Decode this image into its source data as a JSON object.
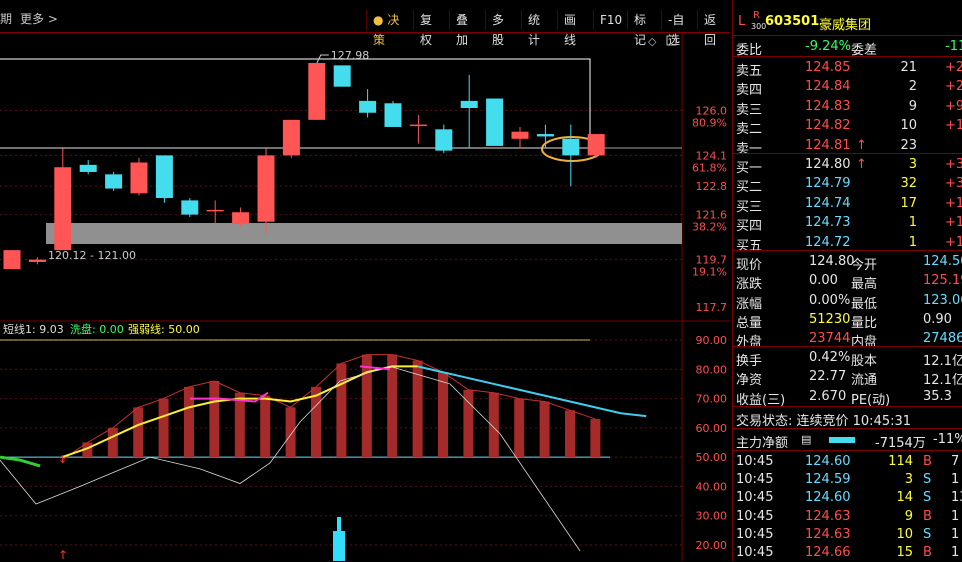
{
  "toolbar": {
    "left_items": [
      "期",
      "更多 >"
    ],
    "buttons": [
      "决策",
      "复权",
      "叠加",
      "多股",
      "统计",
      "画线",
      "F10",
      "标记",
      "-自选",
      "返回"
    ]
  },
  "main_chart": {
    "price_axis": [
      "126.0",
      "80.9%",
      "124.1",
      "61.8%",
      "122.8",
      "121.6",
      "38.2%",
      "119.7",
      "19.1%",
      "117.7"
    ],
    "high_label": "127.98",
    "range_label": "120.12 - 121.00",
    "indicator_line": {
      "name1": "短线1: 9.03",
      "name2": "洗盘: 0.00",
      "name3": "强弱线: 50.00"
    },
    "indicator_axis": [
      "90.00",
      "80.00",
      "70.00",
      "60.00",
      "50.00",
      "40.00",
      "30.00",
      "20.00"
    ],
    "colors": {
      "up": "#ff5555",
      "down": "#44ddee",
      "box": "#ffffff",
      "zone": "#909090",
      "ellipse": "#f0b040"
    }
  },
  "chart_data": {
    "type": "candlestick",
    "candles": [
      {
        "open": 119.3,
        "close": 120.1,
        "high": 120.1,
        "low": 119.3
      },
      {
        "open": 119.6,
        "close": 119.7,
        "high": 119.8,
        "low": 119.5
      },
      {
        "open": 120.1,
        "close": 123.6,
        "high": 124.4,
        "low": 120.1
      },
      {
        "open": 123.7,
        "close": 123.4,
        "high": 123.9,
        "low": 123.3
      },
      {
        "open": 123.3,
        "close": 122.7,
        "high": 123.4,
        "low": 122.6
      },
      {
        "open": 122.5,
        "close": 123.8,
        "high": 124.0,
        "low": 122.4
      },
      {
        "open": 124.1,
        "close": 122.3,
        "high": 124.1,
        "low": 122.1
      },
      {
        "open": 122.2,
        "close": 121.6,
        "high": 122.3,
        "low": 121.5
      },
      {
        "open": 121.8,
        "close": 121.8,
        "high": 122.2,
        "low": 121.2
      },
      {
        "open": 121.2,
        "close": 121.7,
        "high": 121.9,
        "low": 121.1
      },
      {
        "open": 121.3,
        "close": 124.1,
        "high": 124.4,
        "low": 120.8
      },
      {
        "open": 124.1,
        "close": 125.6,
        "high": 125.6,
        "low": 124.0
      },
      {
        "open": 125.6,
        "close": 128.0,
        "high": 128.0,
        "low": 125.6
      },
      {
        "open": 127.9,
        "close": 127.0,
        "high": 127.9,
        "low": 127.0
      },
      {
        "open": 126.4,
        "close": 125.9,
        "high": 126.9,
        "low": 125.7
      },
      {
        "open": 126.3,
        "close": 125.3,
        "high": 126.4,
        "low": 125.3
      },
      {
        "open": 125.4,
        "close": 125.4,
        "high": 125.8,
        "low": 124.6
      },
      {
        "open": 125.2,
        "close": 124.3,
        "high": 125.4,
        "low": 124.2
      },
      {
        "open": 126.4,
        "close": 126.1,
        "high": 127.5,
        "low": 124.4
      },
      {
        "open": 126.5,
        "close": 124.5,
        "high": 126.5,
        "low": 124.5
      },
      {
        "open": 124.8,
        "close": 125.1,
        "high": 125.3,
        "low": 124.4
      },
      {
        "open": 125.0,
        "close": 124.9,
        "high": 125.4,
        "low": 124.4
      },
      {
        "open": 124.8,
        "close": 124.1,
        "high": 125.4,
        "low": 122.8
      },
      {
        "open": 124.1,
        "close": 125.0,
        "high": 125.0,
        "low": 124.0
      }
    ],
    "indicator_bars": [
      49,
      55,
      60,
      67,
      70,
      74,
      76,
      72,
      71,
      67,
      74,
      82,
      85,
      85,
      83,
      79,
      73,
      72,
      70,
      69,
      66,
      63,
      61,
      60
    ],
    "ylim": [
      117.7,
      128.0
    ]
  },
  "right_panel": {
    "header": {
      "prefix": "L",
      "badge_top": "R",
      "badge_bottom": "300",
      "code": "603501",
      "name": "豪威集团"
    },
    "weibi": {
      "label1": "委比",
      "value1": "-9.24%",
      "label2": "委差",
      "value2": "-11"
    },
    "asks": [
      {
        "label": "卖五",
        "price": "124.85",
        "vol": "21",
        "chg": "+21"
      },
      {
        "label": "卖四",
        "price": "124.84",
        "vol": "2",
        "chg": "+2"
      },
      {
        "label": "卖三",
        "price": "124.83",
        "vol": "9",
        "chg": "+9"
      },
      {
        "label": "卖二",
        "price": "124.82",
        "vol": "10",
        "chg": "+10"
      },
      {
        "label": "卖一",
        "price": "124.81",
        "vol": "23",
        "chg": ""
      }
    ],
    "bids": [
      {
        "label": "买一",
        "price": "124.80",
        "vol": "3",
        "chg": "+3"
      },
      {
        "label": "买二",
        "price": "124.79",
        "vol": "32",
        "chg": "+32"
      },
      {
        "label": "买三",
        "price": "124.74",
        "vol": "17",
        "chg": "+17"
      },
      {
        "label": "买四",
        "price": "124.73",
        "vol": "1",
        "chg": "+1"
      },
      {
        "label": "买五",
        "price": "124.72",
        "vol": "1",
        "chg": "+1"
      }
    ],
    "quotes": [
      {
        "l1": "现价",
        "v1": "124.80",
        "l2": "今开",
        "v2": "124.50"
      },
      {
        "l1": "涨跌",
        "v1": "0.00",
        "l2": "最高",
        "v2": "125.19"
      },
      {
        "l1": "涨幅",
        "v1": "0.00%",
        "l2": "最低",
        "v2": "123.06"
      },
      {
        "l1": "总量",
        "v1": "51230",
        "l2": "量比",
        "v2": "0.90"
      },
      {
        "l1": "外盘",
        "v1": "23744",
        "l2": "内盘",
        "v2": "27486"
      }
    ],
    "stats": [
      {
        "l1": "换手",
        "v1": "0.42%",
        "l2": "股本",
        "v2": "12.1亿"
      },
      {
        "l1": "净资",
        "v1": "22.77",
        "l2": "流通",
        "v2": "12.1亿"
      },
      {
        "l1": "收益(三)",
        "v1": "2.670",
        "l2": "PE(动)",
        "v2": "35.3"
      }
    ],
    "trade_status": "交易状态: 连续竞价 10:45:31",
    "main_flow": {
      "label": "主力净额",
      "value": "-7154万",
      "pct": "-11%"
    },
    "ticks": [
      {
        "time": "10:45",
        "price": "124.60",
        "vol": "114",
        "side": "B",
        "extra": "7"
      },
      {
        "time": "10:45",
        "price": "124.59",
        "vol": "3",
        "side": "S",
        "extra": "1"
      },
      {
        "time": "10:45",
        "price": "124.60",
        "vol": "14",
        "side": "S",
        "extra": "13"
      },
      {
        "time": "10:45",
        "price": "124.63",
        "vol": "9",
        "side": "B",
        "extra": "1"
      },
      {
        "time": "10:45",
        "price": "124.63",
        "vol": "10",
        "side": "S",
        "extra": "1"
      },
      {
        "time": "10:45",
        "price": "124.66",
        "vol": "15",
        "side": "B",
        "extra": "1"
      }
    ]
  }
}
